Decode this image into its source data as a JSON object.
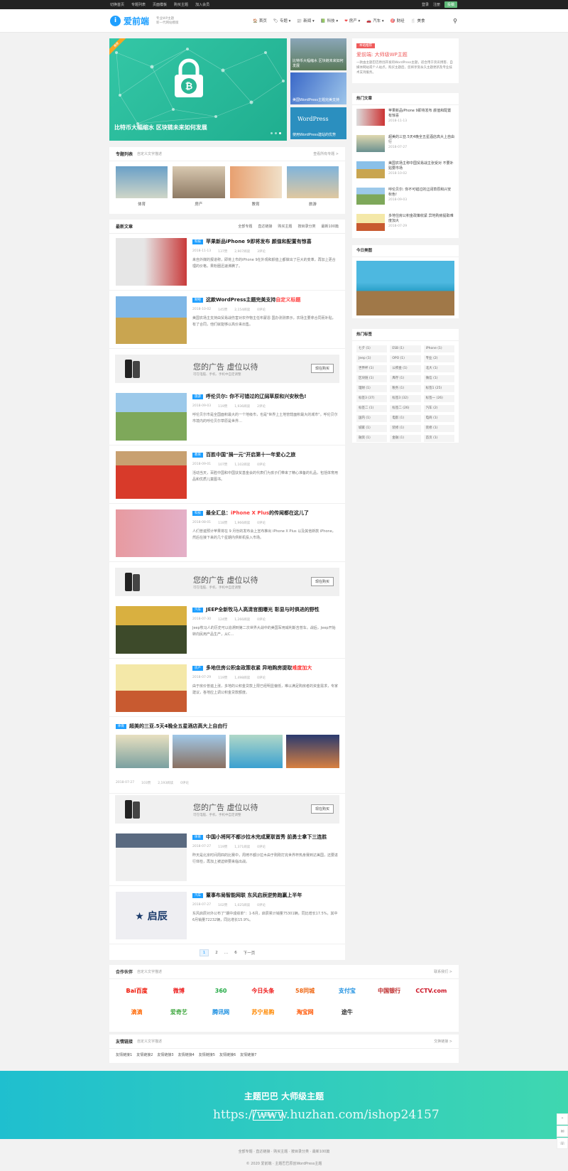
{
  "topbar": {
    "links": [
      "切换首页",
      "专题列表",
      "页面模板",
      "购买主题",
      "加入会员"
    ],
    "login": "登录",
    "register": "注册",
    "vip": "投稿"
  },
  "header": {
    "logo_mark": "i",
    "logo_text": "爱前端",
    "logo_sub1": "专业WP主题",
    "logo_sub2": "新一代网站模版",
    "nav": [
      {
        "icon": "🏠",
        "label": "首页"
      },
      {
        "icon": "🏷",
        "label": "专题"
      },
      {
        "icon": "📰",
        "label": "新闻"
      },
      {
        "icon": "📗",
        "label": "科技"
      },
      {
        "icon": "❤",
        "label": "房产"
      },
      {
        "icon": "🚗",
        "label": "汽车"
      },
      {
        "icon": "🎯",
        "label": "财经"
      },
      {
        "icon": "🍴",
        "label": "美食"
      }
    ]
  },
  "slider": {
    "ribbon": "推荐",
    "caption": "比特币大幅缩水 区块链未来如何发展"
  },
  "side_thumbs": [
    "比特币大幅缩水 区块链未来如何发展",
    "美国WordPress主题完美支持",
    "使用WordPress建站的优势"
  ],
  "topics": {
    "title": "专题列表",
    "desc": "自定义文字描述",
    "more": "查看所有专题 >",
    "items": [
      "体育",
      "房产",
      "教育",
      "旅游"
    ]
  },
  "latest": {
    "title": "最新文章",
    "tabs": [
      "全部专题",
      "直达链接",
      "购买主题",
      "按目录分类",
      "最新100篇"
    ]
  },
  "posts": [
    {
      "tag": "科技",
      "title": "苹果新品iPhone 9即将发布 颜值和配置有惊喜",
      "title_red": "",
      "date": "2018-11-13",
      "likes": "137赞",
      "views": "2,907阅读",
      "comments": "3评论",
      "excerpt": "来自外媒的报道称，即将上市的iPhone 9在外观和颜值上都做出了巨大的变革，再加上更合理的价格，果粉圈迅速沸腾了。"
    },
    {
      "tag": "财经",
      "title": "这款WordPress主题完美支持",
      "title_red": "自定义标题",
      "date": "2018-10-02",
      "likes": "145赞",
      "views": "2,154阅读",
      "comments": "0评论",
      "excerpt": "美国农场主支持由贸易战伤害对农作物主任布蒙恩 国办测测表示，农场主要拿合同而补贴，有了合同，他们就能够以高价来出售。"
    },
    {
      "tag": "旅游",
      "title": "呼伦贝尔: 你不可错过的辽阔草原和兴安秋色!",
      "title_red": "",
      "date": "2018-09-03",
      "likes": "119赞",
      "views": "1,936阅读",
      "comments": "2评论",
      "excerpt": "呼伦贝尔市是全国面积最大的一个地级市，也是\"世界上土地管辖面积最大的城市\"。呼伦贝尔市境内的呼伦贝尔草原是世界…"
    },
    {
      "tag": "教育",
      "title": "百胜中国\"捐一元\"开启第十一年爱心之旅",
      "title_red": "",
      "date": "2018-09-01",
      "likes": "107赞",
      "views": "1,102阅读",
      "comments": "0评论",
      "excerpt": "活动当天，百胜中国和中国扶贫基金会的代表们为孩子们带来了精心准备的礼品，包括体育用品和优质儿童图书。"
    },
    {
      "tag": "科技",
      "title": "最全汇总：",
      "title_red": "iPhone X Plus",
      "title_tail": "的传闻都在这儿了",
      "date": "2018-08-01",
      "likes": "118赞",
      "views": "1,966阅读",
      "comments": "0评论",
      "excerpt": "人们普遍预计苹果将在 9 月份的发布会上宣布推出 iPhone X Plus 以及其他新款 iPhone，然后在接下来的几个星期内供新机投入市场。"
    },
    {
      "tag": "汽车",
      "title": "JEEP全新牧马人高清官图曝光 彰显与时俱进的野性",
      "title_red": "",
      "date": "2018-07-30",
      "likes": "124赞",
      "views": "1,266阅读",
      "comments": "0评论",
      "excerpt": "Jeep牧马人的历史可以追溯到第二次世界大战中的美国军用威利斯吉普车。战后，Jeep开始转向民用产品生产，从C…"
    },
    {
      "tag": "房产",
      "title": "多地住房公积金政策收紧 异地购房提取",
      "title_red": "难度加大",
      "date": "2018-07-29",
      "likes": "119赞",
      "views": "1,498阅读",
      "comments": "0评论",
      "excerpt": "由于房价普遍上涨，多地的公积金贷款上限已经明显偏低，难以满足购房者的资金需求，专家建议，各地应上调公积金贷款额度。"
    }
  ],
  "gallery_post": {
    "tag": "体育",
    "title": "超美的三亚.5天4晚全五星酒店高大上自由行",
    "date": "2018-07-27",
    "likes": "103赞",
    "views": "2,193阅读",
    "comments": "0评论"
  },
  "posts2": [
    {
      "tag": "体育",
      "title": "中国小将阿不都沙拉木完成夏联首秀 前勇士拿下三连胜",
      "title_red": "",
      "date": "2018-07-27",
      "likes": "119赞",
      "views": "1,371阅读",
      "comments": "0评论",
      "excerpt": "昨天是北京时间周四的比赛中，周琦不都沙拉木由于刚刚打完世界杯热身赛到达美国，还要进行体检，再加上被迫转要来临出战。"
    },
    {
      "tag": "汽车",
      "title": "董事布局智能网联 东风启辰逆势跑赢上半年",
      "title_red": "",
      "date": "2018-07-27",
      "likes": "102赞",
      "views": "1,025阅读",
      "comments": "0评论",
      "excerpt": "东风启辰对外公布了\"期中成绩单\"：1-6月，启辰累计销量75301辆，同比增长17.5%，其中6月销量72232辆，同比增长15.9%。"
    }
  ],
  "ad": {
    "big": "您的广告 虚位以待",
    "small": "可在电脑、手机、手机中自定调整",
    "btn": "现在购买"
  },
  "pager": {
    "pages": [
      "1",
      "2",
      "…",
      "6"
    ],
    "next": "下一页"
  },
  "partners": {
    "title": "合作伙伴",
    "desc": "自定义文字描述",
    "more": "联系我们 >",
    "logos": [
      "Bai百度",
      "微博",
      "360",
      "今日头条",
      "58同城",
      "支付宝",
      "中国银行",
      "CCTV.com",
      "滴滴",
      "爱奇艺",
      "腾讯网",
      "苏宁易购",
      "淘宝网",
      "途牛"
    ]
  },
  "friends": {
    "title": "友情链接",
    "desc": "自定义文字描述",
    "more": "交换链接 >",
    "links": [
      "友情链接1",
      "友情链接2",
      "友情链接3",
      "友情链接4",
      "友情链接5",
      "友情链接6",
      "友情链接7"
    ]
  },
  "widgets": {
    "site": {
      "badge": "本站推荐",
      "title": "爱前端: 大师级WP主题",
      "text": "一款由主题巴巴原创开发的WordPress主题，适合用于资讯博客、自媒体网站或个人站点，购买主题后，您将享受永久主题更新及专业技术支持服务。"
    },
    "hot": {
      "title": "热门文章",
      "items": [
        {
          "t": "苹果新品iPhone 9即将发布 颜值和配置有惊喜",
          "d": "2018-11-13"
        },
        {
          "t": "超美的三亚.5天4晚全五星酒店高大上自由行",
          "d": "2018-07-27"
        },
        {
          "t": "美国农场主称中国贸易战主张受对 不要补贴要市场",
          "d": "2018-10-02"
        },
        {
          "t": "呼伦贝尔: 你不可错过的辽阔草原和兴安秋色!",
          "d": "2018-09-03"
        },
        {
          "t": "多地住房公积金政策收紧 异地购房提取难度加大",
          "d": "2018-07-29"
        }
      ]
    },
    "today": {
      "title": "今日美图"
    },
    "tags": {
      "title": "热门标签",
      "items": [
        "七夕 (1)",
        "ESB (1)",
        "iPhone (1)",
        "Jeep (1)",
        "OPO (1)",
        "专业 (2)",
        "世界杯 (1)",
        "公积金 (1)",
        "北大 (1)",
        "区块链 (1)",
        "库存 (1)",
        "微信 (1)",
        "理财 (1)",
        "税务 (1)",
        "标签1 (25)",
        "标签3 (37)",
        "标签3 (32)",
        "标签一 (26)",
        "标签二 (1)",
        "标签二 (26)",
        "汽车 (2)",
        "国内 (1)",
        "电影 (1)",
        "电商 (1)",
        "城家 (1)",
        "装修 (1)",
        "装修 (1)",
        "融资 (1)",
        "金融 (1)",
        "首页 (1)"
      ]
    }
  },
  "footer": {
    "band_title": "主题巴巴 大师级主题",
    "band_btn": "立即购买",
    "watermark": "https://www.huzhan.com/ishop24157",
    "links": [
      "全部专题",
      "直达链接",
      "购买主题",
      "按目录分类",
      "最新100篇"
    ],
    "copy": "© 2020 爱前端 · 主题巴巴原创WordPress主题"
  }
}
